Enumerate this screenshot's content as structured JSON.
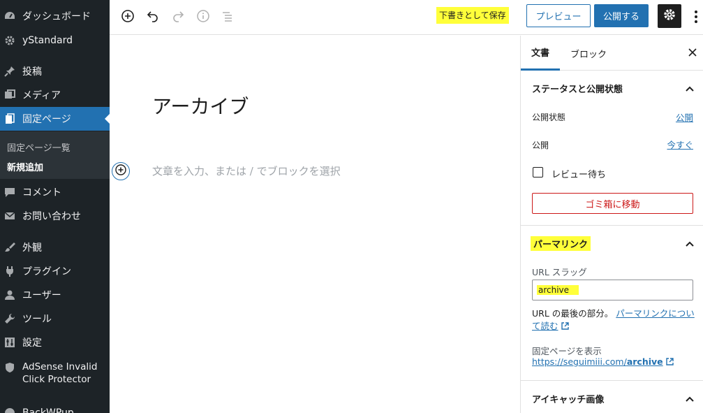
{
  "admin_menu": {
    "items": [
      {
        "label": "ダッシュボード",
        "icon": "dashboard-icon"
      },
      {
        "label": "yStandard",
        "icon": "gear-icon"
      },
      {
        "label": "投稿",
        "icon": "pin-icon"
      },
      {
        "label": "メディア",
        "icon": "media-icon"
      },
      {
        "label": "固定ページ",
        "icon": "pages-icon"
      },
      {
        "label": "コメント",
        "icon": "comment-icon"
      },
      {
        "label": "お問い合わせ",
        "icon": "mail-icon"
      },
      {
        "label": "外観",
        "icon": "brush-icon"
      },
      {
        "label": "プラグイン",
        "icon": "plugin-icon"
      },
      {
        "label": "ユーザー",
        "icon": "user-icon"
      },
      {
        "label": "ツール",
        "icon": "wrench-icon"
      },
      {
        "label": "設定",
        "icon": "settings-icon"
      },
      {
        "label_line1": "AdSense Invalid",
        "label_line2": "Click Protector",
        "icon": "shield-icon"
      },
      {
        "label": "BackWPup",
        "icon": "backup-icon"
      }
    ],
    "submenu": {
      "all_pages": "固定ページ一覧",
      "add_new": "新規追加"
    }
  },
  "toolbar": {
    "save_draft": "下書きとして保存",
    "preview": "プレビュー",
    "publish": "公開する"
  },
  "editor": {
    "title": "アーカイブ",
    "block_placeholder": "文章を入力、または / でブロックを選択"
  },
  "sidebar": {
    "tabs": {
      "document": "文書",
      "block": "ブロック"
    },
    "status": {
      "heading": "ステータスと公開状態",
      "visibility_label": "公開状態",
      "visibility_value": "公開",
      "publish_label": "公開",
      "publish_value": "今すぐ",
      "pending_review": "レビュー待ち",
      "trash": "ゴミ箱に移動"
    },
    "permalink": {
      "heading": "パーマリンク",
      "slug_label": "URL スラッグ",
      "slug_value": "archive",
      "help_text": "URL の最後の部分。",
      "help_link": "パーマリンクについて読む",
      "view_label": "固定ページを表示",
      "url_prefix": "https://seguimiii.com/",
      "url_slug": "archive"
    },
    "featured_image": {
      "heading": "アイキャッチ画像"
    }
  },
  "colors": {
    "admin_bg": "#1d2327",
    "accent": "#2271b1",
    "highlight": "#ffff3a",
    "danger": "#cc1818"
  }
}
